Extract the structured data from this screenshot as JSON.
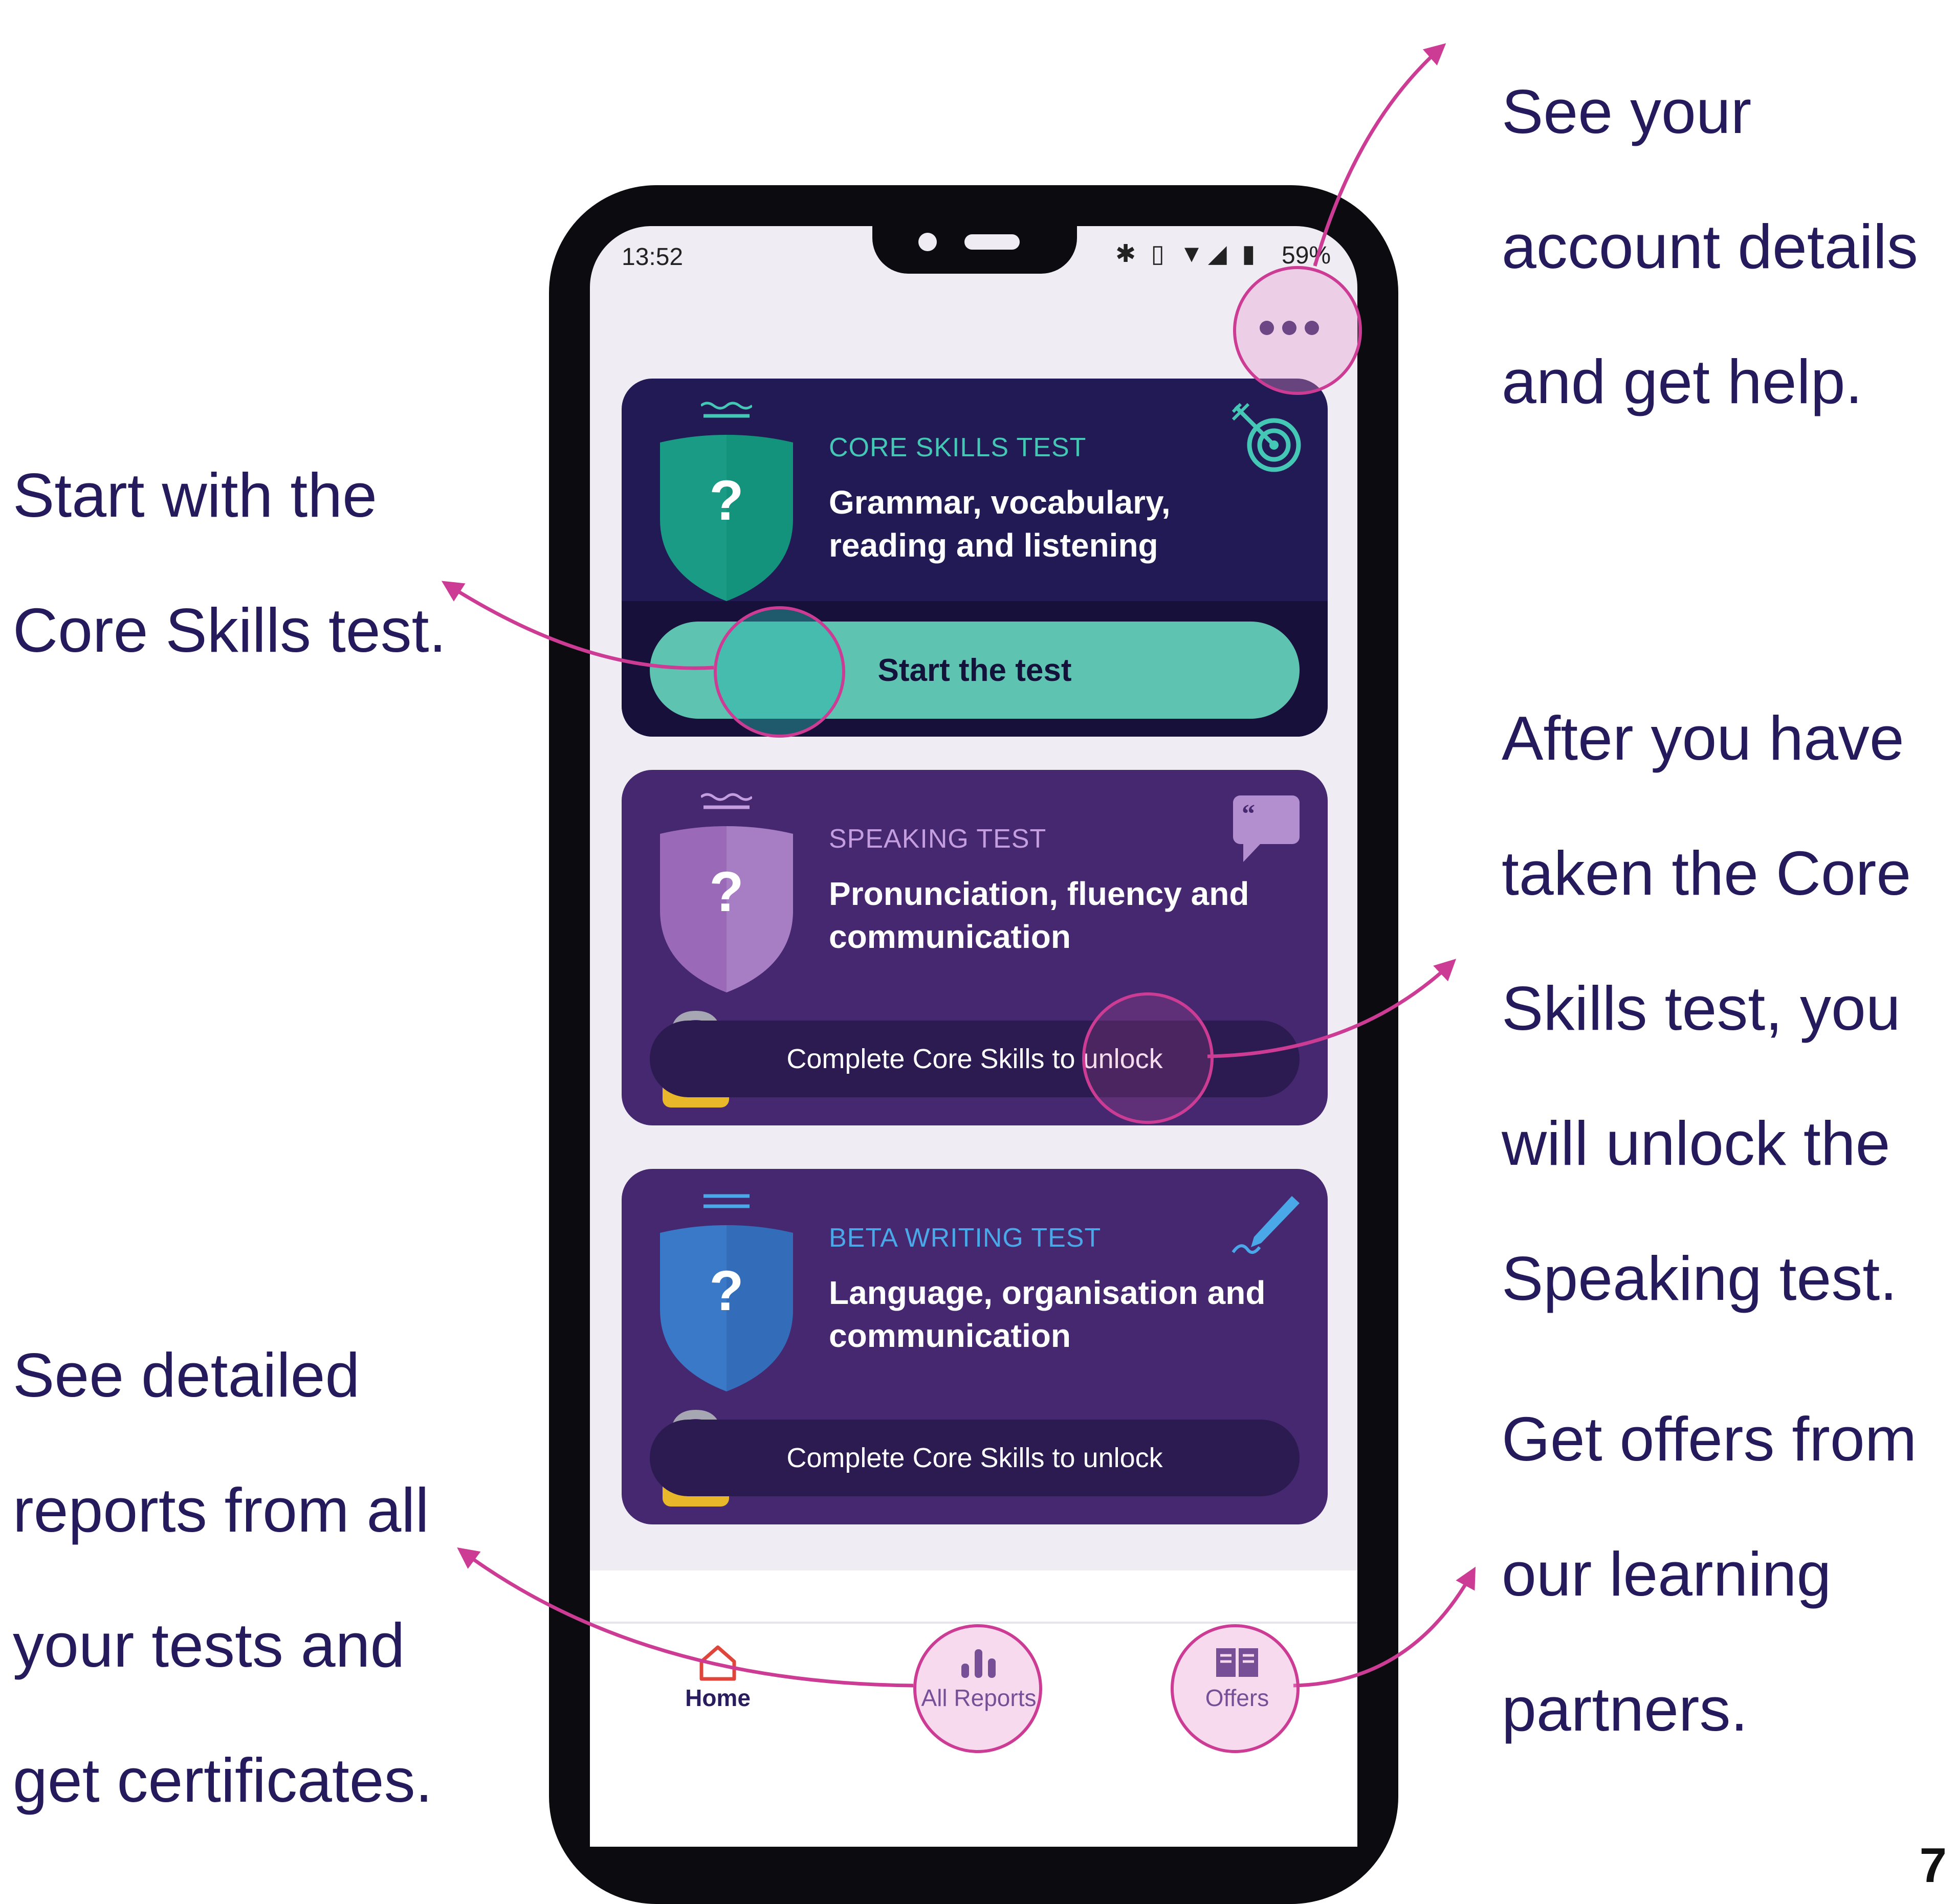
{
  "callouts": {
    "account": [
      "See your",
      "account details",
      "and get help."
    ],
    "core": [
      "Start with the",
      "Core Skills test."
    ],
    "speaking": [
      "After you have",
      "taken the Core",
      "Skills test, you",
      "will unlock the",
      "Speaking test."
    ],
    "reports": [
      "See detailed",
      "reports from all",
      "your tests and",
      "get certificates."
    ],
    "offers": [
      "Get offers from",
      "our learning",
      "partners."
    ]
  },
  "page_number": "7",
  "status_bar": {
    "time": "13:52",
    "battery": "59%",
    "icons": "✱ ▯ ▼◢ ▮"
  },
  "cards": {
    "core": {
      "category": "CORE SKILLS TEST",
      "title": "Grammar, vocabulary, reading and listening",
      "button": "Start the test"
    },
    "speaking": {
      "category": "SPEAKING TEST",
      "title": "Pronunciation, fluency and communication",
      "locked": "Complete Core Skills to unlock"
    },
    "writing": {
      "category": "BETA WRITING TEST",
      "title": "Language, organisation and communication",
      "locked": "Complete Core Skills to unlock"
    }
  },
  "shield_mark": "?",
  "tabs": {
    "home": "Home",
    "reports": "All Reports",
    "offers": "Offers"
  },
  "colors": {
    "accent": "#cc3c94",
    "text": "#241a5c",
    "core": "#1a9b85",
    "speaking": "#9a6ab8",
    "writing": "#3a78c8"
  }
}
